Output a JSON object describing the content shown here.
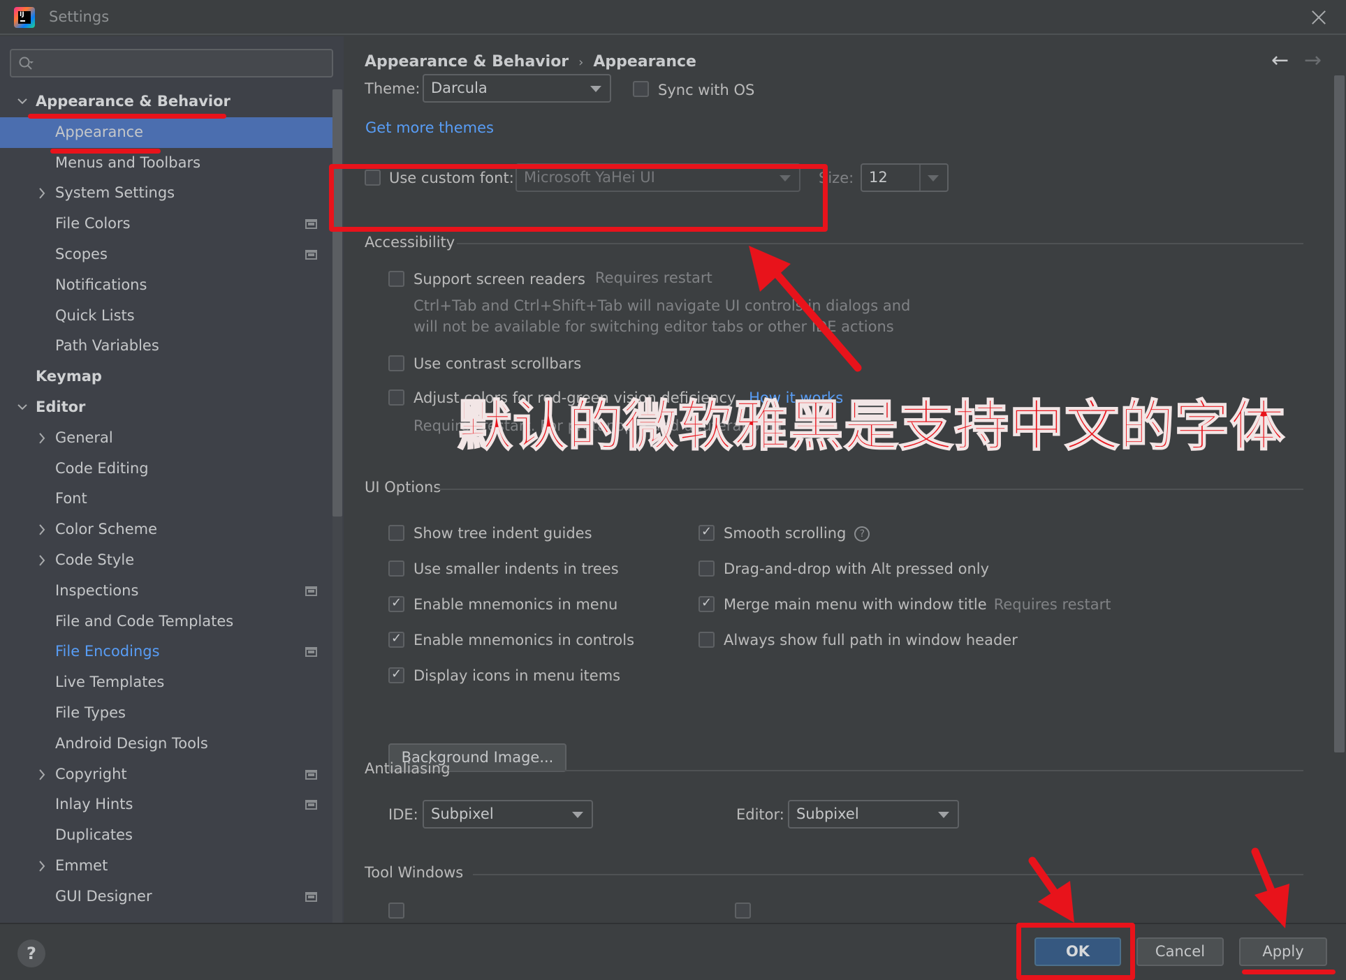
{
  "window": {
    "title": "Settings"
  },
  "sidebar": {
    "search_placeholder": "",
    "items": [
      {
        "label": "Appearance & Behavior",
        "level": 0,
        "bold": true,
        "expander": "down"
      },
      {
        "label": "Appearance",
        "level": 1,
        "selected": true
      },
      {
        "label": "Menus and Toolbars",
        "level": 1
      },
      {
        "label": "System Settings",
        "level": 1,
        "expander": "right"
      },
      {
        "label": "File Colors",
        "level": 1,
        "project_icon": true
      },
      {
        "label": "Scopes",
        "level": 1,
        "project_icon": true
      },
      {
        "label": "Notifications",
        "level": 1
      },
      {
        "label": "Quick Lists",
        "level": 1
      },
      {
        "label": "Path Variables",
        "level": 1
      },
      {
        "label": "Keymap",
        "level": 0,
        "bold": true
      },
      {
        "label": "Editor",
        "level": 0,
        "bold": true,
        "expander": "down"
      },
      {
        "label": "General",
        "level": 1,
        "expander": "right"
      },
      {
        "label": "Code Editing",
        "level": 1
      },
      {
        "label": "Font",
        "level": 1
      },
      {
        "label": "Color Scheme",
        "level": 1,
        "expander": "right"
      },
      {
        "label": "Code Style",
        "level": 1,
        "expander": "right"
      },
      {
        "label": "Inspections",
        "level": 1,
        "project_icon": true
      },
      {
        "label": "File and Code Templates",
        "level": 1
      },
      {
        "label": "File Encodings",
        "level": 1,
        "project_icon": true,
        "link": true
      },
      {
        "label": "Live Templates",
        "level": 1
      },
      {
        "label": "File Types",
        "level": 1
      },
      {
        "label": "Android Design Tools",
        "level": 1
      },
      {
        "label": "Copyright",
        "level": 1,
        "expander": "right",
        "project_icon": true
      },
      {
        "label": "Inlay Hints",
        "level": 1,
        "project_icon": true
      },
      {
        "label": "Duplicates",
        "level": 1
      },
      {
        "label": "Emmet",
        "level": 1,
        "expander": "right"
      },
      {
        "label": "GUI Designer",
        "level": 1,
        "project_icon": true
      }
    ]
  },
  "main": {
    "breadcrumb": {
      "parent": "Appearance & Behavior",
      "separator": "›",
      "current": "Appearance"
    },
    "nav": {
      "back": "←",
      "forward": "→"
    },
    "theme": {
      "label": "Theme:",
      "value": "Darcula",
      "sync_label": "Sync with OS",
      "sync_checked": false
    },
    "get_more_themes": "Get more themes",
    "custom_font": {
      "label": "Use custom font:",
      "checked": false,
      "font_value": "Microsoft YaHei UI",
      "size_label": "Size:",
      "size_value": "12"
    },
    "accessibility": {
      "title": "Accessibility",
      "screen_readers": {
        "label": "Support screen readers",
        "checked": false,
        "note": "Requires restart",
        "description_line1": "Ctrl+Tab and Ctrl+Shift+Tab will navigate UI controls in dialogs and",
        "description_line2": "will not be available for switching editor tabs or other IDE actions"
      },
      "contrast_scrollbars": {
        "label": "Use contrast scrollbars",
        "checked": false
      },
      "color_deficiency": {
        "label": "Adjust colors for red-green vision deficiency",
        "checked": false,
        "link": "How it works",
        "description": "Requires restart. For protanopia and deuteranopia."
      }
    },
    "ui_options": {
      "title": "UI Options",
      "left": [
        {
          "label": "Show tree indent guides",
          "checked": false
        },
        {
          "label": "Use smaller indents in trees",
          "checked": false
        },
        {
          "label": "Enable mnemonics in menu",
          "checked": true
        },
        {
          "label": "Enable mnemonics in controls",
          "checked": true
        },
        {
          "label": "Display icons in menu items",
          "checked": true
        }
      ],
      "right": [
        {
          "label": "Smooth scrolling",
          "checked": true,
          "help": "?"
        },
        {
          "label": "Drag-and-drop with Alt pressed only",
          "checked": false
        },
        {
          "label": "Merge main menu with window title",
          "checked": true,
          "note": "Requires restart"
        },
        {
          "label": "Always show full path in window header",
          "checked": false
        }
      ],
      "background_image_button": "Background Image..."
    },
    "antialiasing": {
      "title": "Antialiasing",
      "ide_label": "IDE:",
      "ide_value": "Subpixel",
      "editor_label": "Editor:",
      "editor_value": "Subpixel"
    },
    "tool_windows": {
      "title": "Tool Windows"
    }
  },
  "footer": {
    "help": "?",
    "ok": "OK",
    "cancel": "Cancel",
    "apply": "Apply"
  },
  "annotation": {
    "text": "默认的微软雅黑是支持中文的字体",
    "color": "#e8131b"
  }
}
